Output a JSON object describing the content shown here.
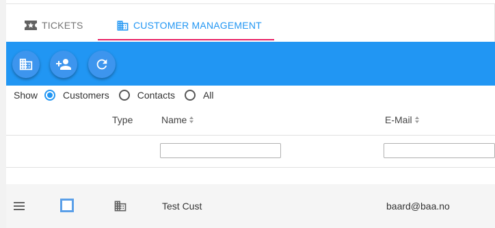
{
  "tabs": [
    {
      "label": "TICKETS",
      "icon": "ticket-star-icon",
      "active": false
    },
    {
      "label": "CUSTOMER MANAGEMENT",
      "icon": "building-icon",
      "active": true
    }
  ],
  "toolbar": {
    "buttons": [
      {
        "icon": "building-icon",
        "action": "add-customer"
      },
      {
        "icon": "add-person-icon",
        "action": "add-contact"
      },
      {
        "icon": "refresh-icon",
        "action": "refresh"
      }
    ]
  },
  "filter": {
    "label": "Show",
    "options": [
      {
        "label": "Customers",
        "checked": true
      },
      {
        "label": "Contacts",
        "checked": false
      },
      {
        "label": "All",
        "checked": false
      }
    ]
  },
  "table": {
    "columns": [
      {
        "label": "Type"
      },
      {
        "label": "Name"
      },
      {
        "label": "E-Mail"
      }
    ],
    "filters": {
      "name": "",
      "email": ""
    },
    "rows": [
      {
        "type_icon": "building-icon",
        "name": "Test Cust",
        "email": "baard@baa.no",
        "selected": false
      }
    ]
  },
  "colors": {
    "primary": "#2196f3",
    "tab_indicator": "#e91e63",
    "fab": "#3d95ee",
    "row_bg": "#f5f5f5"
  }
}
